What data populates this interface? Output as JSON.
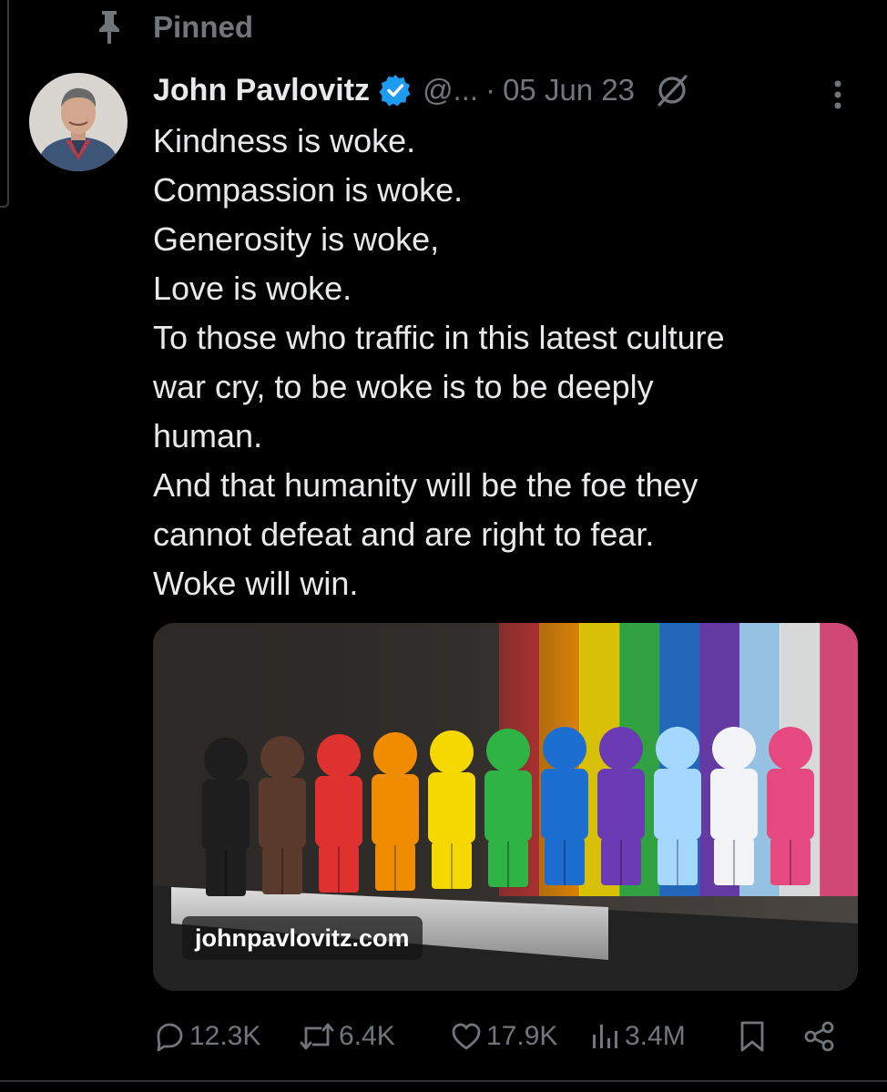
{
  "pinned": {
    "label": "Pinned",
    "icon": "pin-icon"
  },
  "author": {
    "name": "John Pavlovitz",
    "handle": "@...",
    "verified": true,
    "verified_color": "#1d9bf0"
  },
  "post": {
    "separator": "·",
    "date": "05 Jun 23",
    "lines": [
      "Kindness is woke.",
      "Compassion is woke.",
      "Generosity is woke,",
      "Love is woke.",
      "To those who traffic in this latest culture",
      "war cry, to be woke is to be deeply",
      "human.",
      "And that humanity will be the foe they",
      "cannot defeat and are right to fear.",
      "Woke will win."
    ]
  },
  "media": {
    "link_domain": "johnpavlovitz.com",
    "rainbow_colors": [
      "#e03131",
      "#f08c00",
      "#f5d800",
      "#2fb344",
      "#1c6fd1",
      "#6a3bb5",
      "#a5d8ff",
      "#f1f3f5",
      "#e64980"
    ]
  },
  "actions": {
    "replies": "12.3K",
    "reposts": "6.4K",
    "likes": "17.9K",
    "views": "3.4M"
  },
  "colors": {
    "background": "#000000",
    "text_primary": "#e7e9ea",
    "text_secondary": "#71767b",
    "divider": "#2f3336"
  }
}
